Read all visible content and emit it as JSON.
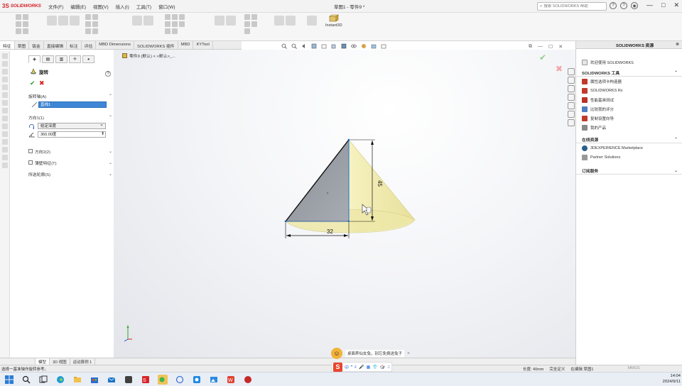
{
  "app": {
    "logo_ds": "3S",
    "logo_text": "SOLIDWORKS",
    "menus": [
      "文件(F)",
      "编辑(E)",
      "视图(V)",
      "插入(I)",
      "工具(T)",
      "窗口(W)"
    ],
    "document_title": "草图1 - 零件9 *",
    "help_search_placeholder": "搜索 SOLIDWORKS 帮助",
    "help_icons": [
      "?",
      "?",
      "◉"
    ],
    "window_controls": [
      "—",
      "□",
      "✕"
    ]
  },
  "command_manager": {
    "instant3d_label": "Instant3D"
  },
  "tabs": [
    "特征",
    "草图",
    "钣金",
    "直接编辑",
    "标注",
    "评估",
    "MBD Dimensions",
    "SOLIDWORKS 插件",
    "MBD",
    "KYTool"
  ],
  "active_tab": "特征",
  "property_manager": {
    "tabs": [
      "◈",
      "▤",
      "▥",
      "✛",
      "◕"
    ],
    "title": "旋转",
    "help": "?",
    "ok": "✔",
    "cancel": "✖",
    "axis_section": {
      "label": "旋转轴(A)",
      "value": "直线1"
    },
    "direction_section": {
      "label": "方向1(1)",
      "type_value": "给定深度",
      "angle_value": "360.00度"
    },
    "direction2": {
      "label": "方向2(2)"
    },
    "thin_feature": {
      "label": "薄壁特征(T)"
    },
    "selected_contours": {
      "label": "所选轮廓(S)"
    }
  },
  "graphics": {
    "breadcrumb": "零件9 (默认) < <默认>_...",
    "dimension_horizontal": "32",
    "dimension_vertical": "45"
  },
  "task_pane": {
    "title": "SOLIDWORKS 资源",
    "welcome": "欢迎使用 SOLIDWORKS",
    "tools_header": "SOLIDWORKS 工具",
    "tools": [
      "属性选项卡构造器",
      "SOLIDWORKS Rx",
      "性能基准测试",
      "比较我的评分",
      "复制设置向导",
      "我的产品"
    ],
    "online_header": "在线资源",
    "online": [
      "3DEXPERIENCE Marketplace",
      "Partner Solutions"
    ],
    "subscription_header": "订阅服务"
  },
  "bottom_tabs": [
    "",
    "模型",
    "3D 视图",
    "运动算例 1"
  ],
  "status": {
    "message": "选择一基准轴作旋转参考。",
    "length": "长度: 40mm",
    "state": "完全定义",
    "editing": "在编辑 草图1",
    "units": "MMGS"
  },
  "ime": {
    "message": "桌面养仙女兔，别忘免费送兔子",
    "close": "×",
    "items": [
      "中",
      "•",
      "ꜰ",
      "🎤",
      "▦",
      "👕",
      "🎲",
      "⁝⁝"
    ]
  },
  "taskbar": {
    "clock_time": "14:04",
    "clock_date": "2024/9/11"
  }
}
